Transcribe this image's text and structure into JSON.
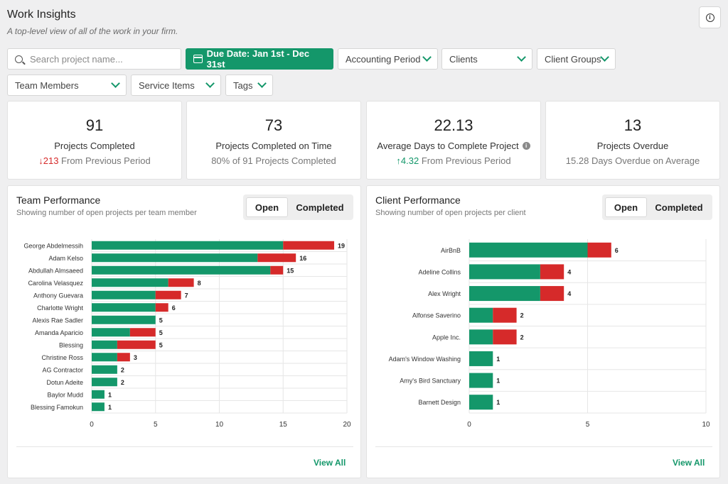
{
  "page": {
    "title": "Work Insights",
    "subtitle": "A top-level view of all of the work in your firm."
  },
  "filters": {
    "search_placeholder": "Search project name...",
    "due_date": "Due Date: Jan 1st - Dec 31st",
    "accounting_period": "Accounting Period",
    "clients": "Clients",
    "client_groups": "Client Groups",
    "team_members": "Team Members",
    "service_items": "Service Items",
    "tags": "Tags"
  },
  "stats": [
    {
      "value": "91",
      "label": "Projects Completed",
      "delta": "213",
      "delta_dir": "down",
      "delta_suffix": " From Previous Period"
    },
    {
      "value": "73",
      "label": "Projects Completed on Time",
      "sub": "80% of 91 Projects Completed"
    },
    {
      "value": "22.13",
      "label": "Average Days to Complete Project",
      "delta": "4.32",
      "delta_dir": "up",
      "delta_suffix": " From Previous Period"
    },
    {
      "value": "13",
      "label": "Projects Overdue",
      "sub": "15.28 Days Overdue on Average"
    }
  ],
  "colors": {
    "on_time": "#14976a",
    "overdue": "#d62a2a",
    "accent": "#14976a"
  },
  "team_panel": {
    "title": "Team Performance",
    "subtitle": "Showing number of open projects per team member",
    "toggle_open": "Open",
    "toggle_completed": "Completed",
    "view_all": "View All"
  },
  "client_panel": {
    "title": "Client Performance",
    "subtitle": "Showing number of open projects per client",
    "toggle_open": "Open",
    "toggle_completed": "Completed",
    "view_all": "View All"
  },
  "chart_data": [
    {
      "type": "bar",
      "orientation": "horizontal",
      "stacked": true,
      "categories": [
        "George Abdelmessih",
        "Adam Kelso",
        "Abdullah Almsaeed",
        "Carolina Velasquez",
        "Anthony Guevara",
        "Charlotte Wright",
        "Alexis Rae Sadler",
        "Amanda Aparicio",
        "Blessing",
        "Christine Ross",
        "AG Contractor",
        "Dotun Adeite",
        "Baylor Mudd",
        "Blessing Famokun"
      ],
      "series": [
        {
          "values": [
            15,
            13,
            14,
            6,
            5,
            5,
            5,
            3,
            2,
            2,
            2,
            2,
            1,
            1
          ]
        },
        {
          "values": [
            4,
            3,
            1,
            2,
            2,
            1,
            0,
            2,
            3,
            1,
            0,
            0,
            0,
            0
          ]
        }
      ],
      "totals": [
        19,
        16,
        15,
        8,
        7,
        6,
        5,
        5,
        5,
        3,
        2,
        2,
        1,
        1
      ],
      "xlim": [
        0,
        20
      ],
      "xticks": [
        0,
        5,
        10,
        15,
        20
      ]
    },
    {
      "type": "bar",
      "orientation": "horizontal",
      "stacked": true,
      "categories": [
        "AirBnB",
        "Adeline Collins",
        "Alex Wright",
        "Alfonse Saverino",
        "Apple Inc.",
        "Adam's Window Washing",
        "Amy's Bird Sanctuary",
        "Barnett Design"
      ],
      "series": [
        {
          "values": [
            5,
            3,
            3,
            1,
            1,
            1,
            1,
            1
          ]
        },
        {
          "values": [
            1,
            1,
            1,
            1,
            1,
            0,
            0,
            0
          ]
        }
      ],
      "totals": [
        6,
        4,
        4,
        2,
        2,
        1,
        1,
        1
      ],
      "xlim": [
        0,
        10
      ],
      "xticks": [
        0,
        5,
        10
      ]
    }
  ]
}
